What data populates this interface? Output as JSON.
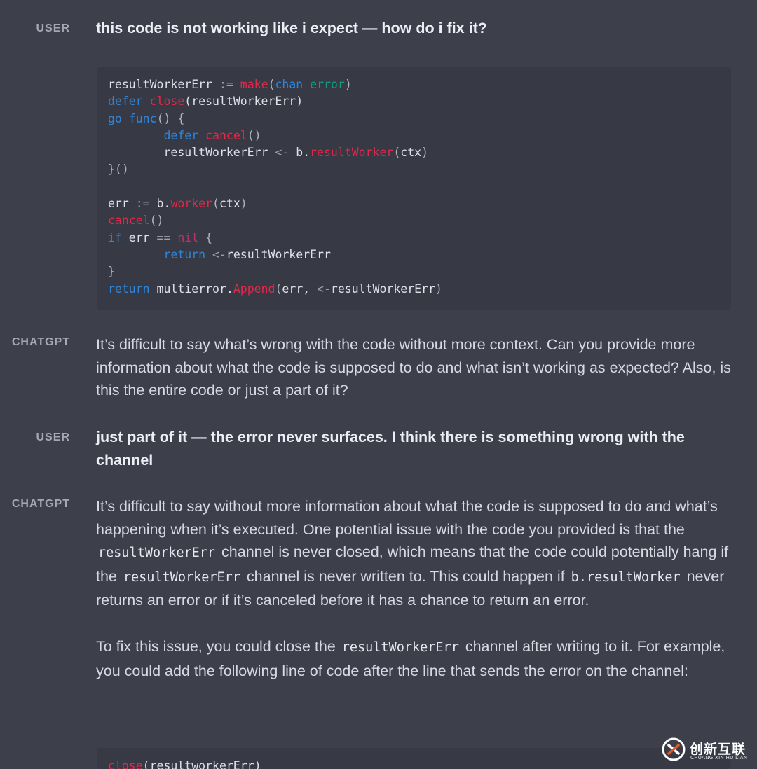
{
  "conversation": {
    "turn1": {
      "role": "USER",
      "text": "this code is not working like i expect — how do i fix it?"
    },
    "code_block1": {
      "lines": [
        [
          {
            "t": "resultWorkerErr ",
            "c": "pl"
          },
          {
            "t": ":=",
            "c": "op"
          },
          {
            "t": " ",
            "c": "pl"
          },
          {
            "t": "make",
            "c": "fn"
          },
          {
            "t": "(",
            "c": "pn"
          },
          {
            "t": "chan",
            "c": "kw"
          },
          {
            "t": " ",
            "c": "pl"
          },
          {
            "t": "error",
            "c": "tp"
          },
          {
            "t": ")",
            "c": "pn"
          }
        ],
        [
          {
            "t": "defer",
            "c": "kw"
          },
          {
            "t": " ",
            "c": "pl"
          },
          {
            "t": "close",
            "c": "fn"
          },
          {
            "t": "(resultWorkerErr)",
            "c": "pl"
          }
        ],
        [
          {
            "t": "go",
            "c": "kw"
          },
          {
            "t": " ",
            "c": "pl"
          },
          {
            "t": "func",
            "c": "kw"
          },
          {
            "t": "() {",
            "c": "pn"
          }
        ],
        [
          {
            "t": "        ",
            "c": "pl"
          },
          {
            "t": "defer",
            "c": "kw"
          },
          {
            "t": " ",
            "c": "pl"
          },
          {
            "t": "cancel",
            "c": "fn"
          },
          {
            "t": "()",
            "c": "pn"
          }
        ],
        [
          {
            "t": "        resultWorkerErr ",
            "c": "pl"
          },
          {
            "t": "<-",
            "c": "op"
          },
          {
            "t": " b.",
            "c": "pl"
          },
          {
            "t": "resultWorker",
            "c": "fn"
          },
          {
            "t": "(",
            "c": "pn"
          },
          {
            "t": "ctx",
            "c": "pl"
          },
          {
            "t": ")",
            "c": "pn"
          }
        ],
        [
          {
            "t": "}()",
            "c": "pn"
          }
        ],
        [],
        [
          {
            "t": "err ",
            "c": "pl"
          },
          {
            "t": ":=",
            "c": "op"
          },
          {
            "t": " b.",
            "c": "pl"
          },
          {
            "t": "worker",
            "c": "fn"
          },
          {
            "t": "(",
            "c": "pn"
          },
          {
            "t": "ctx",
            "c": "pl"
          },
          {
            "t": ")",
            "c": "pn"
          }
        ],
        [
          {
            "t": "cancel",
            "c": "fn"
          },
          {
            "t": "()",
            "c": "pn"
          }
        ],
        [
          {
            "t": "if",
            "c": "kw"
          },
          {
            "t": " err ",
            "c": "pl"
          },
          {
            "t": "==",
            "c": "op"
          },
          {
            "t": " ",
            "c": "pl"
          },
          {
            "t": "nil",
            "c": "nil"
          },
          {
            "t": " {",
            "c": "pn"
          }
        ],
        [
          {
            "t": "        ",
            "c": "pl"
          },
          {
            "t": "return",
            "c": "kw"
          },
          {
            "t": " ",
            "c": "pl"
          },
          {
            "t": "<-",
            "c": "op"
          },
          {
            "t": "resultWorkerErr",
            "c": "pl"
          }
        ],
        [
          {
            "t": "}",
            "c": "pn"
          }
        ],
        [
          {
            "t": "return",
            "c": "kw"
          },
          {
            "t": " multierror.",
            "c": "pl"
          },
          {
            "t": "Append",
            "c": "fn"
          },
          {
            "t": "(",
            "c": "pn"
          },
          {
            "t": "err, ",
            "c": "pl"
          },
          {
            "t": "<-",
            "c": "op"
          },
          {
            "t": "resultWorkerErr",
            "c": "pl"
          },
          {
            "t": ")",
            "c": "pn"
          }
        ]
      ]
    },
    "turn2": {
      "role": "CHATGPT",
      "text": "It’s difficult to say what’s wrong with the code without more context. Can you provide more information about what the code is supposed to do and what isn’t working as expected? Also, is this the entire code or just a part of it?"
    },
    "turn3": {
      "role": "USER",
      "text": "just part of it — the error never surfaces. I think there is something wrong with the channel"
    },
    "turn4": {
      "role": "CHATGPT",
      "p1_a": "It’s difficult to say without more information about what the code is supposed to do and what’s happening when it’s executed. One potential issue with the code you provided is that the ",
      "p1_code1": "resultWorkerErr",
      "p1_b": " channel is never closed, which means that the code could potentially hang if the ",
      "p1_code2": "resultWorkerErr",
      "p1_c": " channel is never written to. This could happen if ",
      "p1_code3": "b.resultWorker",
      "p1_d": " never returns an error or if it’s canceled before it has a chance to return an error.",
      "p2_a": "To fix this issue, you could close the ",
      "p2_code1": "resultWorkerErr",
      "p2_b": " channel after writing to it. For example, you could add the following line of code after the line that sends the error on the channel:"
    },
    "code_block2": {
      "lines": [
        [
          {
            "t": "close",
            "c": "fn"
          },
          {
            "t": "(resultworkerErr)",
            "c": "pl"
          }
        ]
      ]
    }
  },
  "watermark": {
    "icon": "brand-logo-icon",
    "name": "创新互联",
    "sub": "CHUANG XIN HU LIAN"
  }
}
